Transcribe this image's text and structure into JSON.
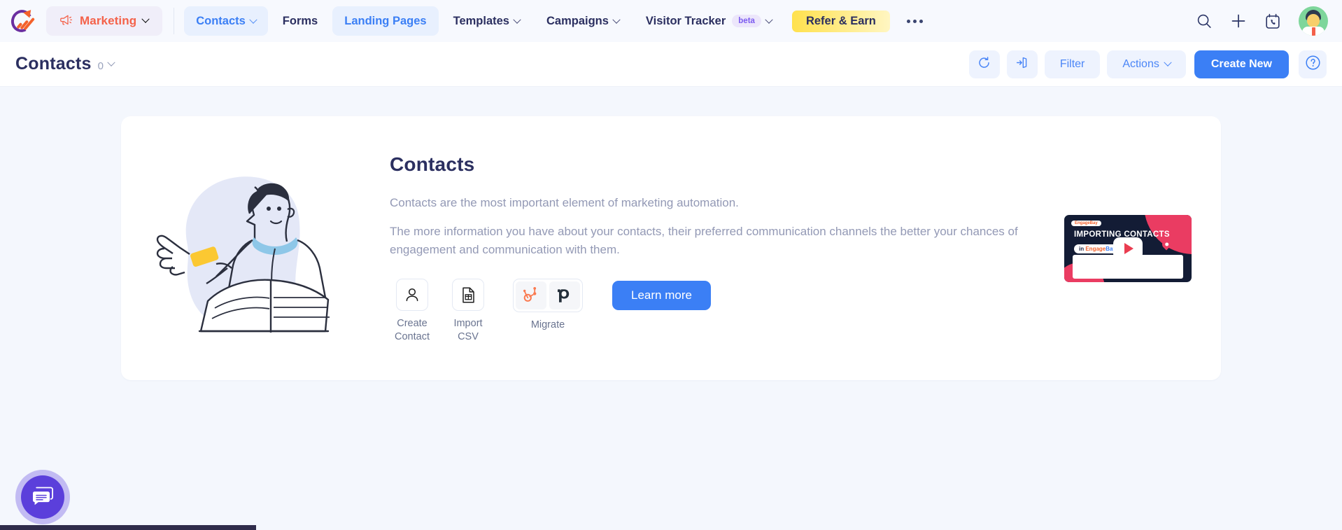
{
  "brand": {
    "logo_name": "engagebay-logo",
    "accent_blue": "#3b7ff5",
    "accent_orange": "#f4624a",
    "title_navy": "#2b2f60"
  },
  "topnav": {
    "workspace": {
      "label": "Marketing",
      "icon": "megaphone-icon",
      "caret": "chevron-down-icon"
    },
    "items": [
      {
        "label": "Contacts",
        "caret": true,
        "state": "selected",
        "badge": null
      },
      {
        "label": "Forms",
        "caret": false,
        "state": "default",
        "badge": null
      },
      {
        "label": "Landing Pages",
        "caret": false,
        "state": "active",
        "badge": null
      },
      {
        "label": "Templates",
        "caret": true,
        "state": "default",
        "badge": null
      },
      {
        "label": "Campaigns",
        "caret": true,
        "state": "default",
        "badge": null
      },
      {
        "label": "Visitor Tracker",
        "caret": true,
        "state": "default",
        "badge": "beta"
      }
    ],
    "refer_label": "Refer & Earn",
    "overflow": "more-options-icon",
    "right_icons": [
      "search-icon",
      "plus-icon",
      "call-schedule-icon",
      "avatar"
    ]
  },
  "subbar": {
    "title": "Contacts",
    "count": "0",
    "caret": "chevron-down-icon",
    "refresh_icon": "refresh-icon",
    "export_icon": "import-export-icon",
    "filter_label": "Filter",
    "actions_label": "Actions",
    "create_label": "Create New",
    "help_icon": "help-circle-icon"
  },
  "card": {
    "illustration": "man-pointing-with-book-illustration",
    "title": "Contacts",
    "paragraph_1": "Contacts are the most important element of marketing automation.",
    "paragraph_2": "The more information you have about your contacts, their preferred communication channels the better your chances of engagement and communication with them.",
    "actions": [
      {
        "icon": "user-add-icon",
        "label": "Create\nContact",
        "line1": "Create",
        "line2": "Contact"
      },
      {
        "icon": "csv-file-icon",
        "label": "Import\nCSV",
        "line1": "Import",
        "line2": "CSV"
      }
    ],
    "migrate": {
      "label": "Migrate",
      "sources": [
        "hubspot-logo-icon",
        "pipedrive-logo-icon"
      ]
    },
    "learn_more_label": "Learn more",
    "video": {
      "title": "IMPORTING CONTACTS",
      "chip_prefix": "in",
      "chip_brand_1": "Engage",
      "chip_brand_2": "Bay",
      "corner_logo": "EngageBay",
      "play": "play-button-icon"
    }
  },
  "chat": {
    "icon": "chat-bubble-icon"
  }
}
